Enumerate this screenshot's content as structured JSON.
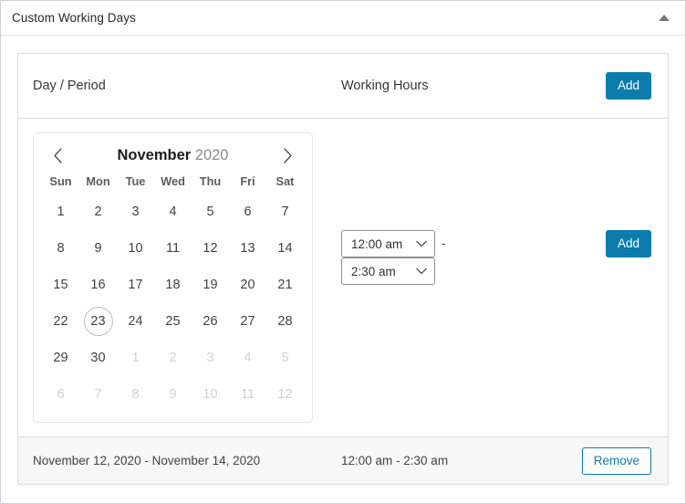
{
  "panel": {
    "title": "Custom Working Days",
    "collapse_icon": "caret-up-icon"
  },
  "table": {
    "headers": {
      "day_period": "Day / Period",
      "working_hours": "Working Hours",
      "add_label": "Add"
    },
    "body": {
      "add_label": "Add",
      "range_separator": "-"
    },
    "footer": {
      "date_range": "November 12, 2020 - November 14, 2020",
      "time_range": "12:00 am - 2:30 am",
      "remove_label": "Remove"
    }
  },
  "datepicker": {
    "prev_icon": "chevron-left-icon",
    "next_icon": "chevron-right-icon",
    "month": "November",
    "year": "2020",
    "weekdays": [
      "Sun",
      "Mon",
      "Tue",
      "Wed",
      "Thu",
      "Fri",
      "Sat"
    ],
    "today": 23,
    "cells": [
      {
        "n": "1",
        "muted": false
      },
      {
        "n": "2",
        "muted": false
      },
      {
        "n": "3",
        "muted": false
      },
      {
        "n": "4",
        "muted": false
      },
      {
        "n": "5",
        "muted": false
      },
      {
        "n": "6",
        "muted": false
      },
      {
        "n": "7",
        "muted": false
      },
      {
        "n": "8",
        "muted": false
      },
      {
        "n": "9",
        "muted": false
      },
      {
        "n": "10",
        "muted": false
      },
      {
        "n": "11",
        "muted": false
      },
      {
        "n": "12",
        "muted": false
      },
      {
        "n": "13",
        "muted": false
      },
      {
        "n": "14",
        "muted": false
      },
      {
        "n": "15",
        "muted": false
      },
      {
        "n": "16",
        "muted": false
      },
      {
        "n": "17",
        "muted": false
      },
      {
        "n": "18",
        "muted": false
      },
      {
        "n": "19",
        "muted": false
      },
      {
        "n": "20",
        "muted": false
      },
      {
        "n": "21",
        "muted": false
      },
      {
        "n": "22",
        "muted": false
      },
      {
        "n": "23",
        "muted": false,
        "today": true
      },
      {
        "n": "24",
        "muted": false
      },
      {
        "n": "25",
        "muted": false
      },
      {
        "n": "26",
        "muted": false
      },
      {
        "n": "27",
        "muted": false
      },
      {
        "n": "28",
        "muted": false
      },
      {
        "n": "29",
        "muted": false
      },
      {
        "n": "30",
        "muted": false
      },
      {
        "n": "1",
        "muted": true
      },
      {
        "n": "2",
        "muted": true
      },
      {
        "n": "3",
        "muted": true
      },
      {
        "n": "4",
        "muted": true
      },
      {
        "n": "5",
        "muted": true
      },
      {
        "n": "6",
        "muted": true
      },
      {
        "n": "7",
        "muted": true
      },
      {
        "n": "8",
        "muted": true
      },
      {
        "n": "9",
        "muted": true
      },
      {
        "n": "10",
        "muted": true
      },
      {
        "n": "11",
        "muted": true
      },
      {
        "n": "12",
        "muted": true
      }
    ]
  },
  "time_selects": {
    "start_value": "12:00 am",
    "end_value": "2:30 am",
    "chevron_icon": "chevron-down-icon"
  },
  "colors": {
    "accent": "#0c7cad",
    "panel_border": "#ccd0d4",
    "footer_bg": "#f7f7f7",
    "muted_day": "#cfd2d6"
  }
}
